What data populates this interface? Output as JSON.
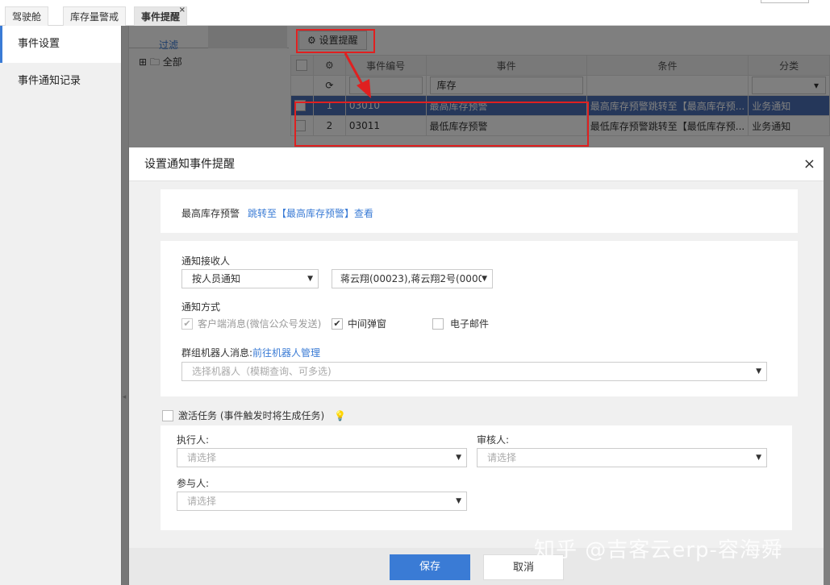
{
  "tabs": [
    {
      "label": "驾驶舱"
    },
    {
      "label": "库存量警戒"
    },
    {
      "label": "事件提醒",
      "close": "×"
    }
  ],
  "sidebar": {
    "items": [
      {
        "label": "事件设置"
      },
      {
        "label": "事件通知记录"
      }
    ]
  },
  "filter": {
    "tab_filter": "过滤",
    "tree_all": "全部"
  },
  "grid": {
    "toolbar_button": "设置提醒",
    "columns": [
      "事件编号",
      "事件",
      "条件",
      "分类"
    ],
    "filter_event_value": "库存",
    "rows": [
      {
        "no": "1",
        "code": "03010",
        "event": "最高库存预警",
        "condition": "最高库存预警跳转至【最高库存预...",
        "category": "业务通知"
      },
      {
        "no": "2",
        "code": "03011",
        "event": "最低库存预警",
        "condition": "最低库存预警跳转至【最低库存预...",
        "category": "业务通知"
      }
    ]
  },
  "modal": {
    "title": "设置通知事件提醒",
    "close": "×",
    "event_name": "最高库存预警",
    "event_link": "跳转至【最高库存预警】查看",
    "receiver_label": "通知接收人",
    "receiver_mode": "按人员通知",
    "receiver_people": "蒋云翔(00023),蒋云翔2号(0000",
    "method_label": "通知方式",
    "method_client": "客户端消息(微信公众号发送)",
    "method_popup": "中间弹窗",
    "method_email": "电子邮件",
    "robot_label": "群组机器人消息:",
    "robot_link": "前往机器人管理",
    "robot_placeholder": "选择机器人（模糊查询、可多选)",
    "activate_label": "激活任务 (事件触发时将生成任务)",
    "executor_label": "执行人:",
    "executor_placeholder": "请选择",
    "reviewer_label": "审核人:",
    "reviewer_placeholder": "请选择",
    "participant_label": "参与人:",
    "participant_placeholder": "请选择",
    "save": "保存",
    "cancel": "取消"
  },
  "watermark": "知乎 @吉客云erp-容海舜",
  "colors": {
    "accent": "#3a7bd5",
    "highlight": "#e02020"
  }
}
